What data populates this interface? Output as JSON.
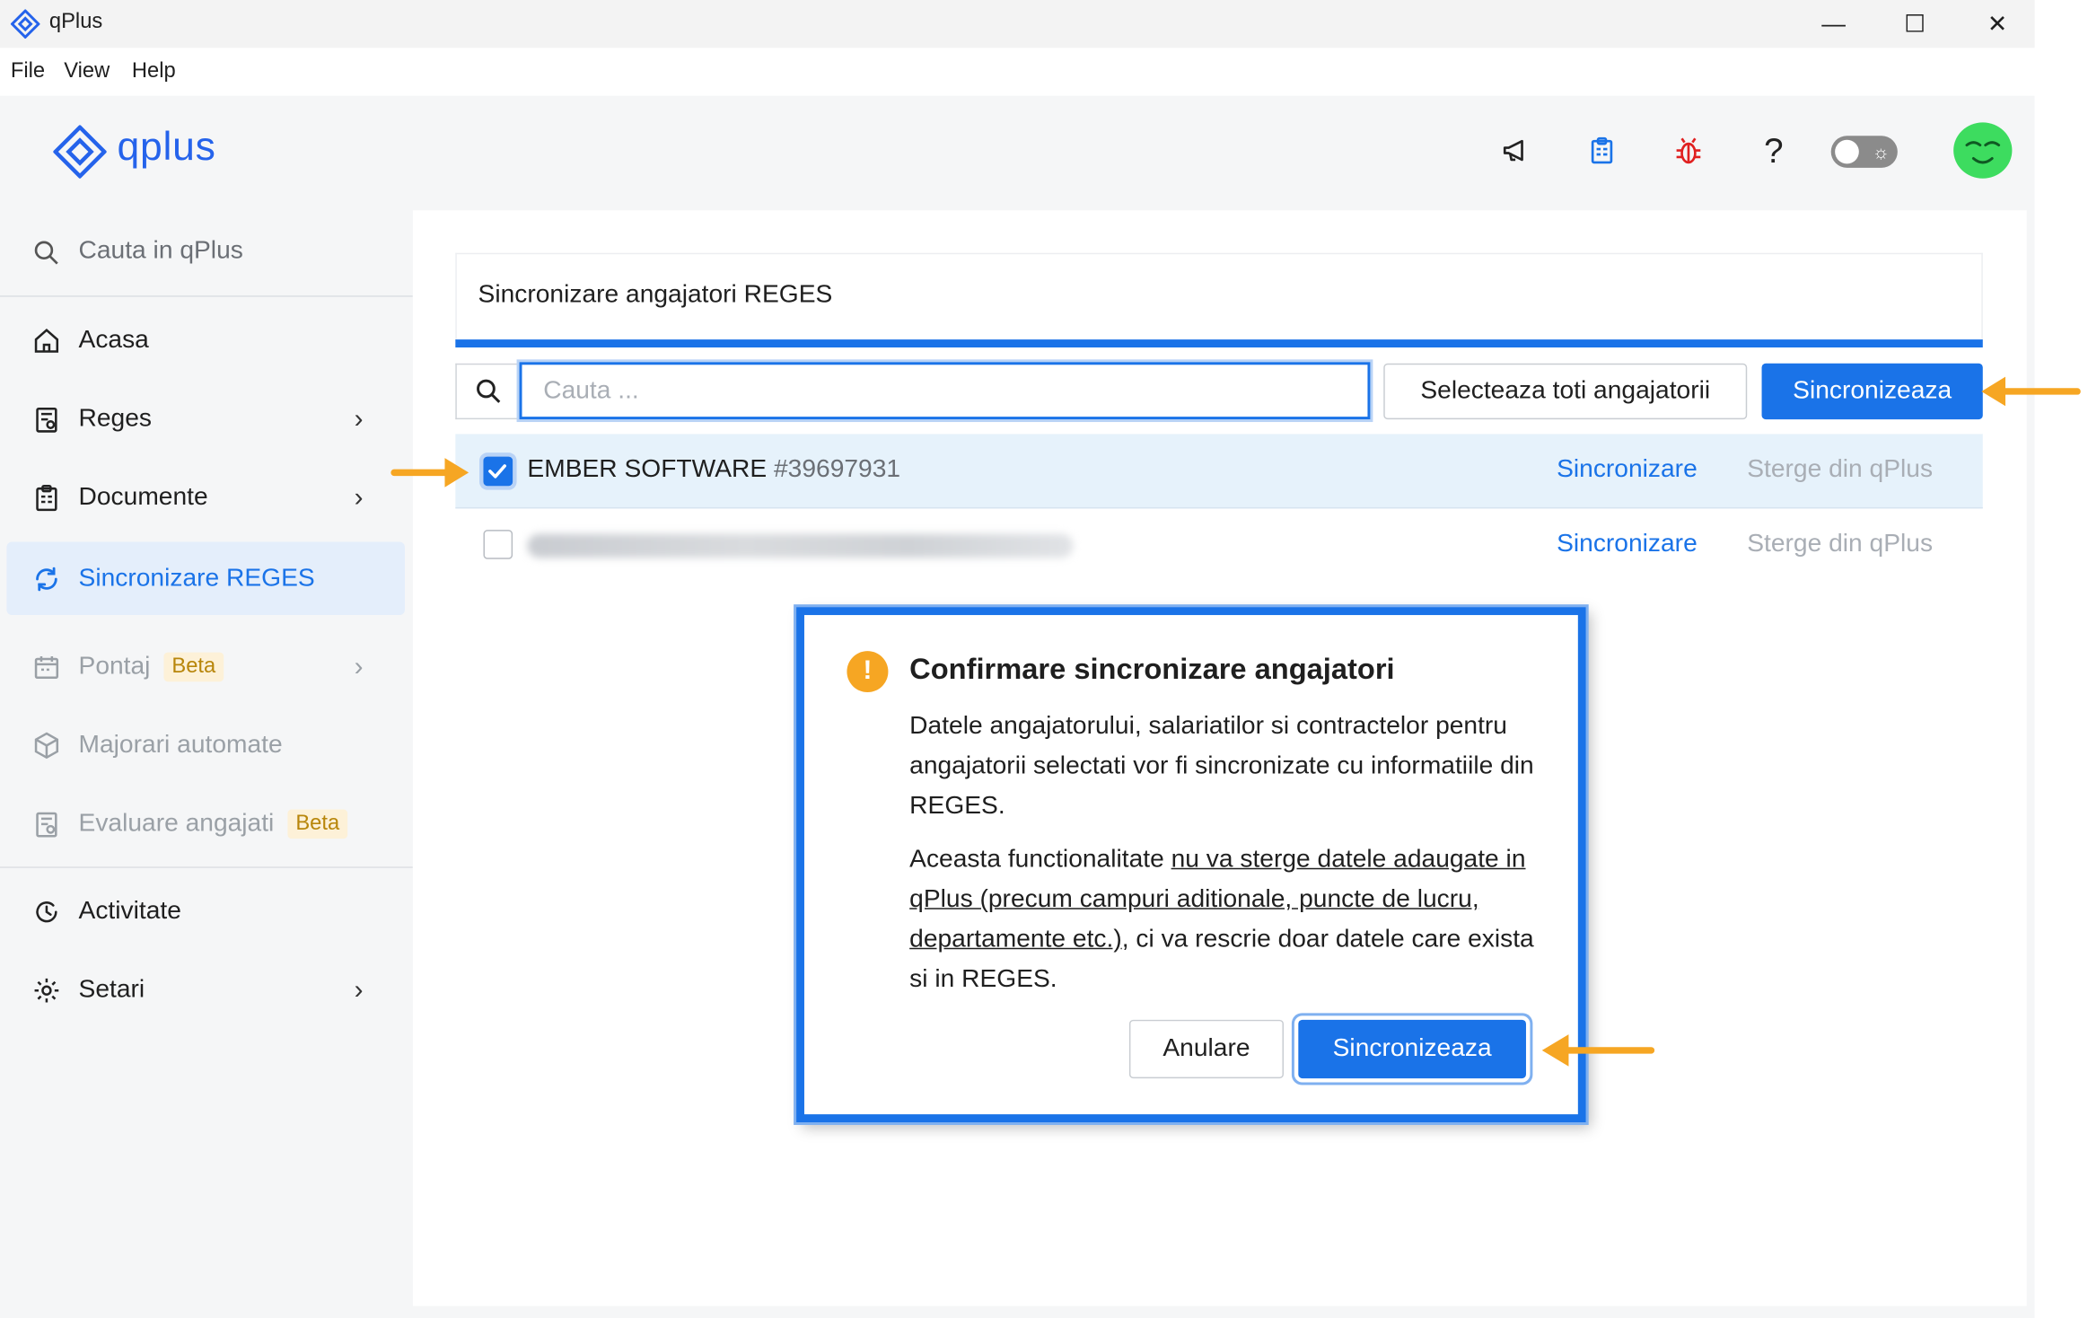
{
  "window": {
    "title": "qPlus",
    "minimize": "—",
    "maximize": "☐",
    "close": "✕"
  },
  "menu": [
    "File",
    "View",
    "Help"
  ],
  "brand": {
    "name": "qplus",
    "color": "#2563eb"
  },
  "header_icons": [
    "megaphone-icon",
    "documents-icon",
    "bug-icon",
    "help-icon",
    "theme-toggle",
    "avatar"
  ],
  "header": {
    "help_glyph": "?",
    "toggle_glyph": "☼"
  },
  "sidebar": {
    "search_placeholder": "Cauta in qPlus",
    "items": [
      {
        "label": "Acasa",
        "icon": "home-icon"
      },
      {
        "label": "Reges",
        "icon": "reges-icon",
        "has_submenu": true
      },
      {
        "label": "Documente",
        "icon": "documents-icon",
        "has_submenu": true
      },
      {
        "label": "Sincronizare REGES",
        "icon": "sync-icon",
        "active": true
      },
      {
        "label": "Pontaj",
        "icon": "calendar-icon",
        "badge": "Beta",
        "disabled": true,
        "has_submenu": true
      },
      {
        "label": "Majorari automate",
        "icon": "cube-icon",
        "disabled": true
      },
      {
        "label": "Evaluare angajati",
        "icon": "evaluation-icon",
        "badge": "Beta",
        "disabled": true
      },
      {
        "label": "Activitate",
        "icon": "history-icon"
      },
      {
        "label": "Setari",
        "icon": "gear-icon",
        "has_submenu": true
      }
    ],
    "chevron": "›",
    "accent": "#1a73e8"
  },
  "main": {
    "title": "Sincronizare angajatori REGES",
    "search_placeholder": "Cauta ...",
    "select_all_label": "Selecteaza toti angajatorii",
    "sync_label": "Sincronizeaza",
    "rows": [
      {
        "name": "EMBER SOFTWARE",
        "id": "#39697931",
        "checked": true,
        "sync_link": "Sincronizare",
        "delete_link": "Sterge din qPlus"
      },
      {
        "name": "",
        "id": "",
        "checked": false,
        "blurred": true,
        "sync_link": "Sincronizare",
        "delete_link": "Sterge din qPlus"
      }
    ]
  },
  "dialog": {
    "title": "Confirmare sincronizare angajatori",
    "warning_glyph": "!",
    "paragraph1": "Datele angajatorului, salariatilor si contractelor pentru angajatorii selectati vor fi sincronizate cu informatiile din REGES.",
    "p2_before": "Aceasta functionalitate ",
    "p2_underlined": "nu va sterge datele adaugate in qPlus (precum campuri aditionale, puncte de lucru, departamente etc.)",
    "p2_after": ", ci va rescrie doar datele care exista si in REGES.",
    "cancel_label": "Anulare",
    "confirm_label": "Sincronizeaza"
  },
  "annotation_color": "#f6a623"
}
